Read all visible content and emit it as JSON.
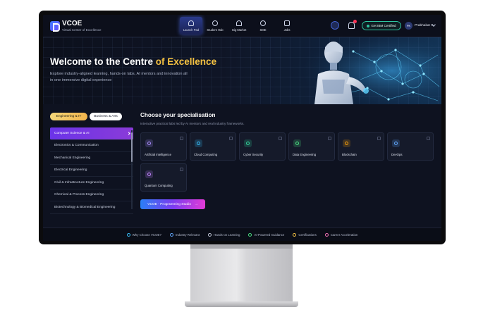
{
  "brand": {
    "name": "VCOE",
    "tagline": "Virtual Center of Excellence"
  },
  "nav": [
    {
      "label": "Launch Pad",
      "icon": "rocket-icon",
      "active": true
    },
    {
      "label": "Student Hub",
      "icon": "hub-icon",
      "active": false
    },
    {
      "label": "Gig Market",
      "icon": "user-icon",
      "active": false
    },
    {
      "label": "SME",
      "icon": "globe-icon",
      "active": false
    },
    {
      "label": "Jobs",
      "icon": "briefcase-icon",
      "active": false
    }
  ],
  "header": {
    "ibm_label": "Get IBM Certified",
    "avatar_initials": "PK",
    "user_name": "Prabhakar K"
  },
  "hero": {
    "title_prefix": "Welcome to the Centre ",
    "title_accent": "of Excellence",
    "description": "Explore industry-aligned learning, hands-on labs, AI mentors and innovation all in one immersive digital experience"
  },
  "tabs": {
    "active": "Engineering & IT",
    "inactive": "Business & Arts"
  },
  "sidebar": {
    "items": [
      {
        "label": "Computer Science & AI",
        "active": true
      },
      {
        "label": "Electronics & Communication",
        "active": false
      },
      {
        "label": "Mechanical Engineering",
        "active": false
      },
      {
        "label": "Electrical Engineering",
        "active": false
      },
      {
        "label": "Civil & Infrastructure Engineering",
        "active": false
      },
      {
        "label": "Chemical & Process Engineering",
        "active": false
      },
      {
        "label": "Biotechnology & Biomedical Engineering",
        "active": false
      }
    ]
  },
  "main": {
    "title": "Choose your specialisation",
    "subtitle": "Interactive practical labs led by AI mentors and real industry frameworks.",
    "cards": [
      {
        "label": "Artificial Intelligence",
        "icon": "brain-icon",
        "color": "#a78bfa"
      },
      {
        "label": "Cloud Computing",
        "icon": "cloud-icon",
        "color": "#38bdf8"
      },
      {
        "label": "Cyber Security",
        "icon": "shield-icon",
        "color": "#34d399"
      },
      {
        "label": "Data Engineering",
        "icon": "database-icon",
        "color": "#4ade80"
      },
      {
        "label": "Blockchain",
        "icon": "blockchain-icon",
        "color": "#f59e0b"
      },
      {
        "label": "DevOps",
        "icon": "infinity-icon",
        "color": "#60a5fa"
      },
      {
        "label": "Quantum Computing",
        "icon": "atom-icon",
        "color": "#c084fc"
      }
    ],
    "studio_button": "VCOE - Programming Studio",
    "studio_arrow": "→"
  },
  "footer": [
    {
      "label": "Why Choose VCOE?",
      "icon": "info-icon",
      "color": "#38bdf8"
    },
    {
      "label": "Industry Relevant",
      "icon": "building-icon",
      "color": "#60a5fa"
    },
    {
      "label": "Hands-on Learning",
      "icon": "code-icon",
      "color": "#c4c9d9"
    },
    {
      "label": "AI-Powered Guidance",
      "icon": "thumbs-up-icon",
      "color": "#4ade80"
    },
    {
      "label": "Certifications",
      "icon": "certificate-icon",
      "color": "#f5c242"
    },
    {
      "label": "Career Acceleration",
      "icon": "rocket-icon",
      "color": "#f472b6"
    }
  ]
}
